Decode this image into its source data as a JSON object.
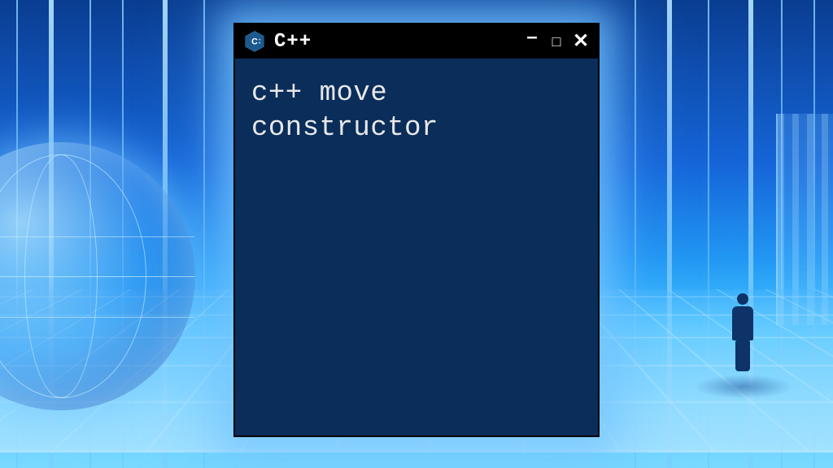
{
  "window": {
    "title": "C++",
    "icon_name": "cpp-hexagon-icon",
    "controls": {
      "minimize": "–",
      "maximize": "□",
      "close": "✕"
    }
  },
  "terminal": {
    "line1": "c++ move",
    "line2": "constructor"
  },
  "colors": {
    "terminal_bg": "#0a2d5a",
    "titlebar_bg": "#000000",
    "text": "#e8e8e8",
    "glow": "#78c8ff"
  }
}
